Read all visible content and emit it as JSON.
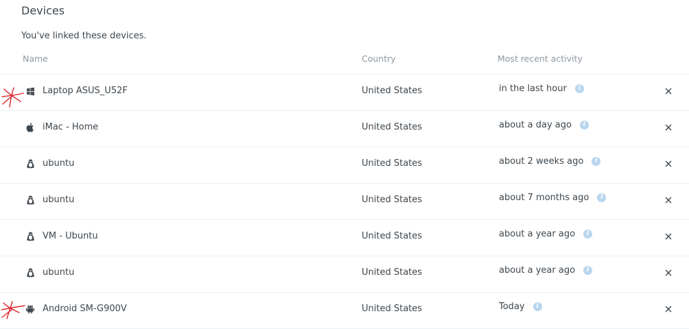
{
  "section": {
    "title": "Devices",
    "intro": "You've linked these devices."
  },
  "table": {
    "columns": [
      "Name",
      "Country",
      "Most recent activity"
    ],
    "rows": [
      {
        "icon": "windows-icon",
        "name": "Laptop ASUS_U52F",
        "country": "United States",
        "activity": "in the last hour"
      },
      {
        "icon": "apple-icon",
        "name": "iMac - Home",
        "country": "United States",
        "activity": "about a day ago"
      },
      {
        "icon": "linux-icon",
        "name": "ubuntu",
        "country": "United States",
        "activity": "about 2 weeks ago"
      },
      {
        "icon": "linux-icon",
        "name": "ubuntu",
        "country": "United States",
        "activity": "about 7 months ago"
      },
      {
        "icon": "linux-icon",
        "name": "VM - Ubuntu",
        "country": "United States",
        "activity": "about a year ago"
      },
      {
        "icon": "linux-icon",
        "name": "ubuntu",
        "country": "United States",
        "activity": "about a year ago"
      },
      {
        "icon": "android-icon",
        "name": "Android SM-G900V",
        "country": "United States",
        "activity": "Today"
      }
    ]
  },
  "icons": {
    "info": "info-icon",
    "remove": "close-icon"
  },
  "colors": {
    "text": "#3d464d",
    "header_text": "#8e979f",
    "info_icon": "#b9d6ef",
    "divider": "#eceef0",
    "annotation": "#e0202a"
  }
}
